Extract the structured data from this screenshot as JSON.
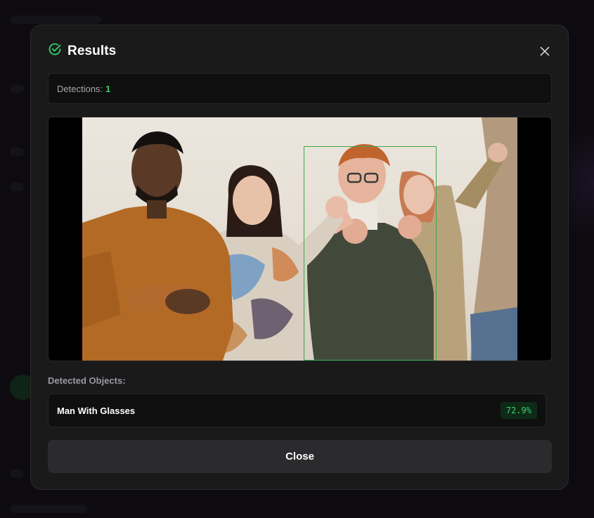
{
  "modal": {
    "title": "Results",
    "close_icon": "close-icon",
    "check_icon": "check-circle-icon"
  },
  "detections": {
    "label": "Detections:",
    "count": "1"
  },
  "image": {
    "detections": [
      {
        "label": "Man With Glasses",
        "confidence": "72.9%"
      }
    ]
  },
  "detected_objects": {
    "heading": "Detected Objects:",
    "items": [
      {
        "name": "Man With Glasses",
        "confidence": "72.9%"
      }
    ]
  },
  "footer": {
    "close_label": "Close"
  },
  "colors": {
    "accent_green": "#35d06a",
    "modal_bg": "#1a1a1b",
    "button_bg": "#2b2b2d"
  }
}
